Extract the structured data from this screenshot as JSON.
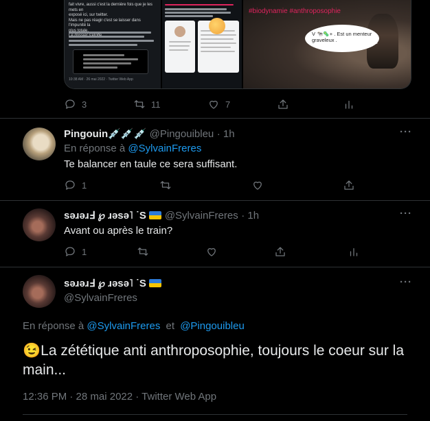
{
  "top_tweet": {
    "media_a_lines": [
      "fait vivre, aussi c'est la dernière fois que je les mets en",
      "exposé ici, sur twitter.",
      "Mais ne pas réagir c'est se laisser dans l'impunité la",
      "plus totale.",
      "Le dossier s'étoffe."
    ],
    "media_a_footer": "10:38 AM · 26 mai 2022 · Twitter Web App",
    "media_c_hashtags": "#biodynamie #anthroposophie",
    "media_c_bubble": "V 🐄🦠+ . Est un menteur graveleux .",
    "media_c_subtitle": "",
    "reply_count": "3",
    "retweet_count": "11",
    "like_count": "7"
  },
  "reply1": {
    "name": "Pingouin💉💉💉",
    "handle": "@Pingouibleu",
    "time": "· 1h",
    "reply_prefix": "En réponse à",
    "reply_to": "@SylvainFreres",
    "text": "Te balancer en taule ce sera suffisant.",
    "reply_count": "1"
  },
  "reply2": {
    "name": "sǝɹǝɹℲ ℘ ɹǝsǝ˥ ˙S",
    "handle": "@SylvainFreres",
    "time": "· 1h",
    "text": "Avant ou après le train?",
    "reply_count": "1"
  },
  "main_tweet": {
    "name": "sǝɹǝɹℲ ℘ ɹǝsǝ˥ ˙S",
    "handle": "@SylvainFreres",
    "reply_prefix": "En réponse à",
    "reply_to_1": "@SylvainFreres",
    "reply_and": "et",
    "reply_to_2": "@Pingouibleu",
    "text": "😉La zététique anti anthroposophie, toujours le coeur sur la main...",
    "timestamp": "12:36 PM · 28 mai 2022 · Twitter Web App"
  },
  "more_label": "···",
  "colors": {
    "background": "#000000",
    "text": "#e7e9ea",
    "muted": "#71767b",
    "link": "#1d9bf0",
    "divider": "#2f3336"
  },
  "icons": [
    "reply-icon",
    "retweet-icon",
    "like-icon",
    "share-icon",
    "analytics-icon",
    "more-icon"
  ]
}
